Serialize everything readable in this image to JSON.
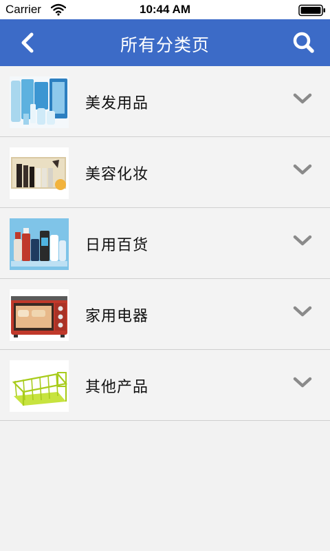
{
  "status_bar": {
    "carrier": "Carrier",
    "time": "10:44 AM"
  },
  "nav": {
    "title": "所有分类页",
    "back_icon": "chevron-left-icon",
    "search_icon": "search-icon",
    "color": "#3c6bc7"
  },
  "categories": [
    {
      "label": "美发用品",
      "thumbnail": "hair-care-products-image"
    },
    {
      "label": "美容化妆",
      "thumbnail": "cosmetics-gift-box-image"
    },
    {
      "label": "日用百货",
      "thumbnail": "daily-necessities-bottles-image"
    },
    {
      "label": "家用电器",
      "thumbnail": "toaster-oven-image"
    },
    {
      "label": "其他产品",
      "thumbnail": "dish-rack-image"
    }
  ]
}
